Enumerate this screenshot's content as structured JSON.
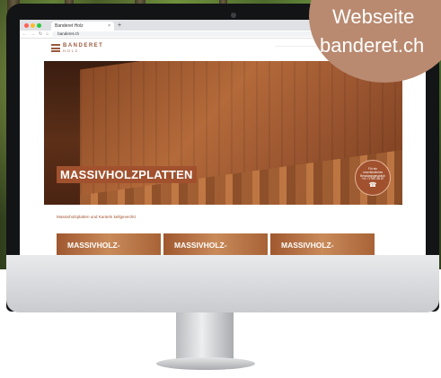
{
  "browser": {
    "tab_title": "Banderet Holz",
    "tab_close": "×",
    "new_tab": "+",
    "url": "banderet.ch",
    "window_dots": [
      "#ff5f57",
      "#febc2e",
      "#28c840"
    ]
  },
  "site": {
    "logo_name": "BANDERET",
    "logo_sub": "HOLZ",
    "hero_title": "MASSIVHOLZPLATTEN",
    "cta_line1": "Für ein",
    "cta_line2": "unverbindliches",
    "cta_line3": "Beratungsgespräch",
    "cta_phone": "+41 71 987 88 87",
    "cta_icon": "☎",
    "section_label": "Massivholzplatten und Kanteln kellgeverzkt",
    "cards": [
      "MASSIVHOLZ-",
      "MASSIVHOLZ-",
      "MASSIVHOLZ-"
    ]
  },
  "badge": {
    "line1": "Webseite",
    "line2": "banderet.ch"
  },
  "colors": {
    "brand": "#a1512e",
    "badge": "#b98a70"
  }
}
